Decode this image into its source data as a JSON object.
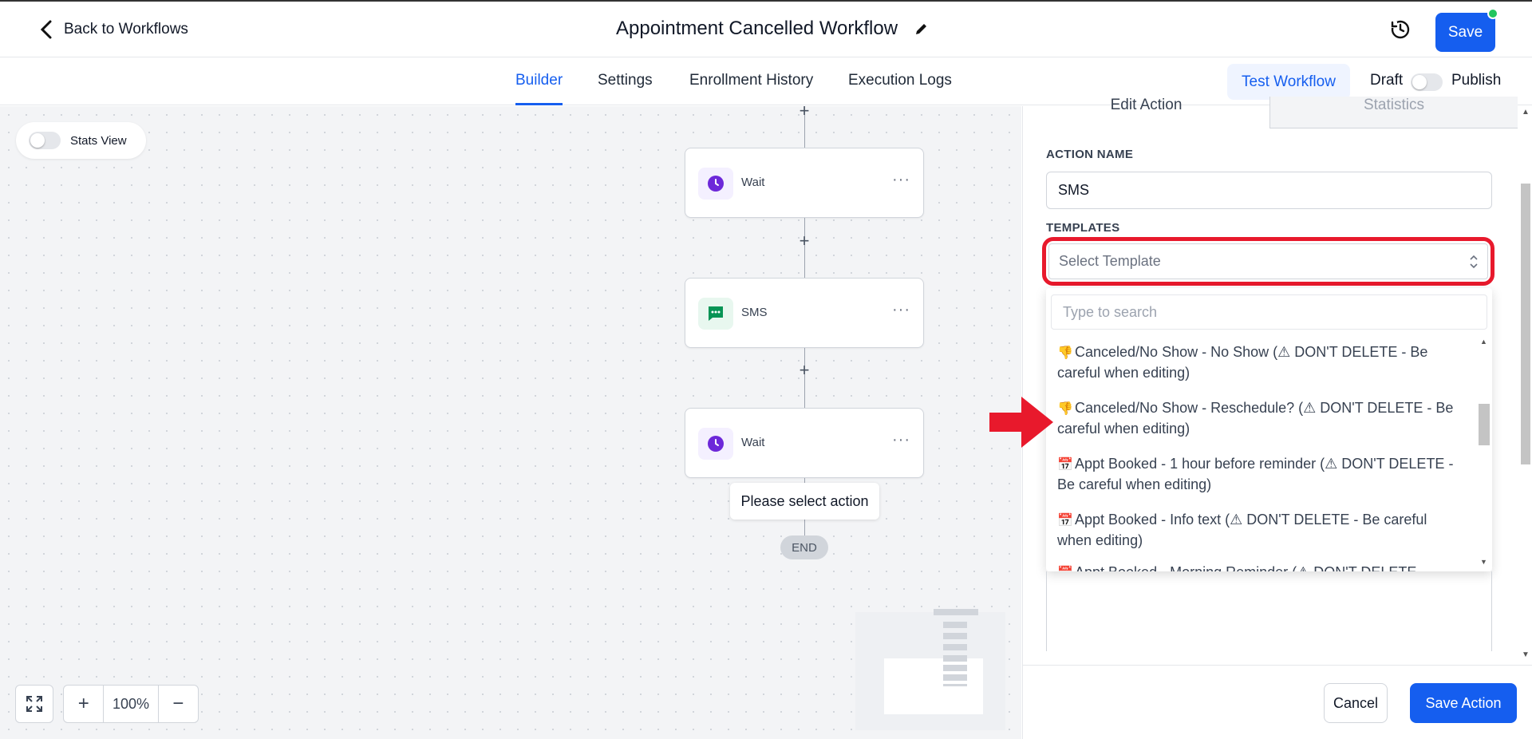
{
  "header": {
    "back_label": "Back to Workflows",
    "title": "Appointment Cancelled Workflow",
    "save_label": "Save"
  },
  "tabs": [
    {
      "label": "Builder",
      "active": true
    },
    {
      "label": "Settings"
    },
    {
      "label": "Enrollment History"
    },
    {
      "label": "Execution Logs"
    }
  ],
  "toolbar": {
    "test_label": "Test Workflow",
    "draft_label": "Draft",
    "publish_label": "Publish",
    "publish_toggle_on": false
  },
  "canvas": {
    "stats_view_label": "Stats View",
    "nodes": [
      {
        "label": "Wait",
        "icon": "clock-icon"
      },
      {
        "label": "SMS",
        "icon": "sms-icon"
      },
      {
        "label": "Wait",
        "icon": "clock-icon"
      }
    ],
    "tooltip": "Please select action",
    "end_label": "END",
    "zoom_level": "100%"
  },
  "panel": {
    "tabs": [
      "Edit Action",
      "Statistics"
    ],
    "action_name_label": "ACTION NAME",
    "action_name_value": "SMS",
    "templates_label": "TEMPLATES",
    "select_placeholder": "Select Template",
    "search_placeholder": "Type to search",
    "options": [
      {
        "emoji": "👎",
        "text": "Canceled/No Show - No Show (⚠ DON'T DELETE - Be careful when editing)"
      },
      {
        "emoji": "👎",
        "text": "Canceled/No Show - Reschedule? (⚠ DON'T DELETE - Be careful when editing)"
      },
      {
        "emoji": "📅",
        "text": "Appt Booked - 1 hour before reminder (⚠ DON'T DELETE - Be careful when editing)"
      },
      {
        "emoji": "📅",
        "text": "Appt Booked - Info text (⚠ DON'T DELETE - Be careful when editing)"
      },
      {
        "emoji": "📅",
        "text": "Appt Booked - Morning Reminder (⚠ DON'T DELETE"
      }
    ],
    "cancel_label": "Cancel",
    "save_action_label": "Save Action"
  },
  "colors": {
    "primary": "#155EEF",
    "highlight": "#E8192C",
    "wait_icon": "#6D28D9",
    "sms_icon": "#079455"
  }
}
